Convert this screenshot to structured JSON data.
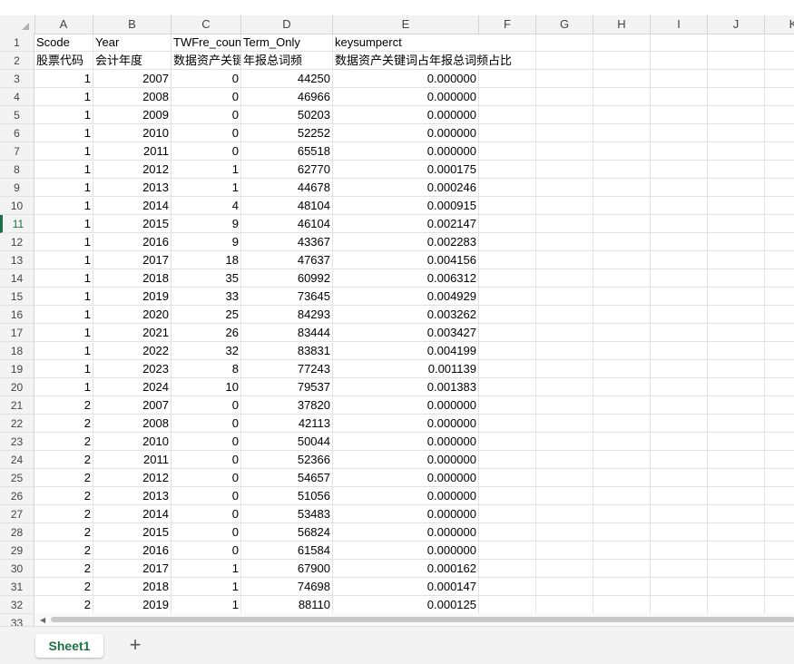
{
  "columns": [
    "A",
    "B",
    "C",
    "D",
    "E",
    "F",
    "G",
    "H",
    "I",
    "J",
    "K"
  ],
  "header_row": [
    "Scode",
    "Year",
    "TWFre_count",
    "Term_Only",
    "keysumperct"
  ],
  "label_row": [
    "股票代码",
    "会计年度",
    "数据资产关键词频",
    "年报总词频",
    "数据资产关键词占年报总词频占比"
  ],
  "row_numbers": [
    "1",
    "2",
    "3",
    "4",
    "5",
    "6",
    "7",
    "8",
    "9",
    "10",
    "11",
    "12",
    "13",
    "14",
    "15",
    "16",
    "17",
    "18",
    "19",
    "20",
    "21",
    "22",
    "23",
    "24",
    "25",
    "26",
    "27",
    "28",
    "29",
    "30",
    "31",
    "32",
    "33"
  ],
  "data_rows": [
    [
      "1",
      "2007",
      "0",
      "44250",
      "0.000000"
    ],
    [
      "1",
      "2008",
      "0",
      "46966",
      "0.000000"
    ],
    [
      "1",
      "2009",
      "0",
      "50203",
      "0.000000"
    ],
    [
      "1",
      "2010",
      "0",
      "52252",
      "0.000000"
    ],
    [
      "1",
      "2011",
      "0",
      "65518",
      "0.000000"
    ],
    [
      "1",
      "2012",
      "1",
      "62770",
      "0.000175"
    ],
    [
      "1",
      "2013",
      "1",
      "44678",
      "0.000246"
    ],
    [
      "1",
      "2014",
      "4",
      "48104",
      "0.000915"
    ],
    [
      "1",
      "2015",
      "9",
      "46104",
      "0.002147"
    ],
    [
      "1",
      "2016",
      "9",
      "43367",
      "0.002283"
    ],
    [
      "1",
      "2017",
      "18",
      "47637",
      "0.004156"
    ],
    [
      "1",
      "2018",
      "35",
      "60992",
      "0.006312"
    ],
    [
      "1",
      "2019",
      "33",
      "73645",
      "0.004929"
    ],
    [
      "1",
      "2020",
      "25",
      "84293",
      "0.003262"
    ],
    [
      "1",
      "2021",
      "26",
      "83444",
      "0.003427"
    ],
    [
      "1",
      "2022",
      "32",
      "83831",
      "0.004199"
    ],
    [
      "1",
      "2023",
      "8",
      "77243",
      "0.001139"
    ],
    [
      "1",
      "2024",
      "10",
      "79537",
      "0.001383"
    ],
    [
      "2",
      "2007",
      "0",
      "37820",
      "0.000000"
    ],
    [
      "2",
      "2008",
      "0",
      "42113",
      "0.000000"
    ],
    [
      "2",
      "2010",
      "0",
      "50044",
      "0.000000"
    ],
    [
      "2",
      "2011",
      "0",
      "52366",
      "0.000000"
    ],
    [
      "2",
      "2012",
      "0",
      "54657",
      "0.000000"
    ],
    [
      "2",
      "2013",
      "0",
      "51056",
      "0.000000"
    ],
    [
      "2",
      "2014",
      "0",
      "53483",
      "0.000000"
    ],
    [
      "2",
      "2015",
      "0",
      "56824",
      "0.000000"
    ],
    [
      "2",
      "2016",
      "0",
      "61584",
      "0.000000"
    ],
    [
      "2",
      "2017",
      "1",
      "67900",
      "0.000162"
    ],
    [
      "2",
      "2018",
      "1",
      "74698",
      "0.000147"
    ],
    [
      "2",
      "2019",
      "1",
      "88110",
      "0.000125"
    ]
  ],
  "active_row": "11",
  "sheet_tabs": [
    "Sheet1"
  ],
  "add_sheet_symbol": "+",
  "colors": {
    "accent": "#1e7145",
    "header_bg": "#f3f3f3",
    "gridline": "#e2e2e2"
  }
}
